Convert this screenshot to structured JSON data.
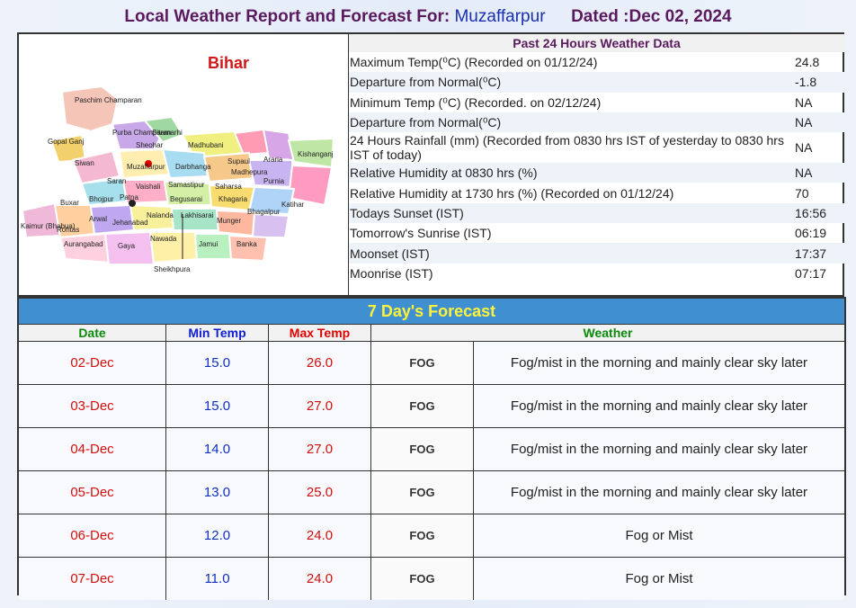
{
  "header": {
    "prefix": "Local Weather Report and Forecast For:",
    "city": "Muzaffarpur",
    "dated": "Dated :Dec 02, 2024"
  },
  "map": {
    "state": "Bihar",
    "districts": [
      "Paschim Champaran",
      "Purba Champaran",
      "Sitamarhi",
      "Sheohar",
      "Gopal Ganj",
      "Siwan",
      "Madhubani",
      "Supaul",
      "Araria",
      "Kishanganj",
      "Muzaffarpur",
      "Darbhanga",
      "Madhepura",
      "Purnia",
      "Saran",
      "Vaishali",
      "Samastipur",
      "Saharsa",
      "Katihar",
      "Buxar",
      "Bhojpur",
      "Patna",
      "Begusarai",
      "Khagaria",
      "Bhagalpur",
      "Kaimur (Bhabua)",
      "Rohtas",
      "Arwal",
      "Jehanabad",
      "Nalanda",
      "Lakhisarai",
      "Munger",
      "Aurangabad",
      "Gaya",
      "Nawada",
      "Jamui",
      "Banka",
      "Sheikhpura"
    ]
  },
  "past24": {
    "title": "Past 24 Hours Weather Data",
    "rows": [
      {
        "label": "Maximum Temp(⁰C) (Recorded on 01/12/24)",
        "value": "24.8"
      },
      {
        "label": "Departure from Normal(⁰C)",
        "value": "-1.8"
      },
      {
        "label": "Minimum Temp (⁰C) (Recorded. on 02/12/24)",
        "value": "NA"
      },
      {
        "label": "Departure from Normal(⁰C)",
        "value": "NA"
      },
      {
        "label": "24 Hours Rainfall (mm) (Recorded from 0830 hrs IST of yesterday to 0830 hrs IST of today)",
        "value": "NA"
      },
      {
        "label": "Relative Humidity at 0830 hrs (%)",
        "value": "NA"
      },
      {
        "label": "Relative Humidity at 1730 hrs (%) (Recorded on 01/12/24)",
        "value": "70"
      },
      {
        "label": "Todays Sunset (IST)",
        "value": "16:56"
      },
      {
        "label": "Tomorrow's Sunrise (IST)",
        "value": "06:19"
      },
      {
        "label": "Moonset (IST)",
        "value": "17:37"
      },
      {
        "label": "Moonrise (IST)",
        "value": "07:17"
      }
    ]
  },
  "forecast": {
    "title": "7 Day's Forecast",
    "headers": {
      "date": "Date",
      "min": "Min Temp",
      "max": "Max Temp",
      "weather": "Weather"
    },
    "rows": [
      {
        "date": "02-Dec",
        "min": "15.0",
        "max": "26.0",
        "icon": "FOG",
        "weather": "Fog/mist in the morning and mainly clear sky later"
      },
      {
        "date": "03-Dec",
        "min": "15.0",
        "max": "27.0",
        "icon": "FOG",
        "weather": "Fog/mist in the morning and mainly clear sky later"
      },
      {
        "date": "04-Dec",
        "min": "14.0",
        "max": "27.0",
        "icon": "FOG",
        "weather": "Fog/mist in the morning and mainly clear sky later"
      },
      {
        "date": "05-Dec",
        "min": "13.0",
        "max": "25.0",
        "icon": "FOG",
        "weather": "Fog/mist in the morning and mainly clear sky later"
      },
      {
        "date": "06-Dec",
        "min": "12.0",
        "max": "24.0",
        "icon": "FOG",
        "weather": "Fog or Mist"
      },
      {
        "date": "07-Dec",
        "min": "11.0",
        "max": "24.0",
        "icon": "FOG",
        "weather": "Fog or Mist"
      }
    ]
  }
}
